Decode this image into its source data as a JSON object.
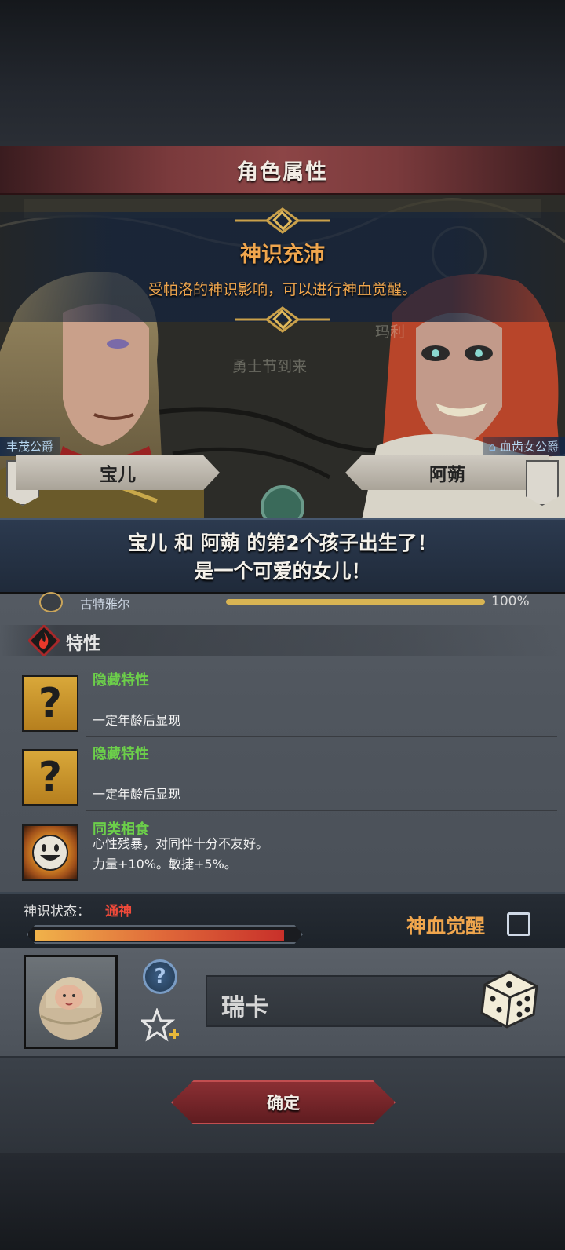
{
  "window": {
    "title": "角色属性"
  },
  "notice": {
    "title": "神识充沛",
    "description": "受帕洛的神识影响，可以进行神血觉醒。"
  },
  "scene": {
    "faded_map_label": "玛利",
    "faded_event": "勇士节到来",
    "father": {
      "title": "丰茂公爵",
      "name": "宝儿"
    },
    "mother": {
      "title": "血齿女公爵",
      "name": "阿蒴"
    }
  },
  "birth_message": {
    "line1": "宝儿 和 阿蒴 的第2个孩子出生了！",
    "line2": "是一个可爱的女儿！"
  },
  "inheritance": {
    "name": "古特雅尔",
    "percent_text": "100%",
    "fraction": 1.0
  },
  "traits_section": {
    "title": "特性",
    "items": [
      {
        "icon": "question-mark-icon",
        "name": "隐藏特性",
        "desc": "一定年龄后显现"
      },
      {
        "icon": "question-mark-icon",
        "name": "隐藏特性",
        "desc": "一定年龄后显现"
      },
      {
        "icon": "smiling-face-icon",
        "name": "同类相食",
        "desc1": "心性残暴，对同伴十分不友好。",
        "desc2": "力量+10%。敏捷+5%。"
      }
    ]
  },
  "divine_status": {
    "label": "神识状态：",
    "value": "通神",
    "fill_fraction": 0.96,
    "awaken_label": "神血觉醒",
    "awaken_checked": false
  },
  "child": {
    "name_value": "瑞卡"
  },
  "confirm_label": "确定",
  "colors": {
    "accent_orange": "#f0a64d",
    "trait_green": "#6ccf4a",
    "status_red": "#f04a3a"
  }
}
